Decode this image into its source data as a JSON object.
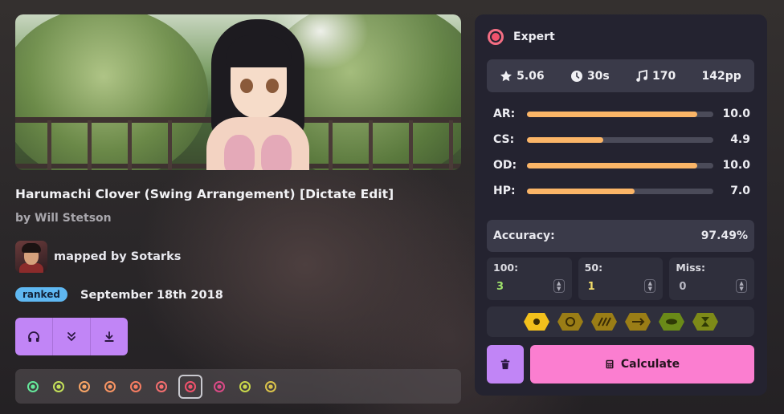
{
  "beatmap": {
    "title": "Harumachi Clover (Swing Arrangement) [Dictate Edit]",
    "artist": "by Will Stetson",
    "mapper": "mapped by Sotarks",
    "status": "ranked",
    "date": "September 18th 2018"
  },
  "actions": [
    {
      "name": "listen-button",
      "icon": "headphones-icon"
    },
    {
      "name": "expand-button",
      "icon": "chevron-double-down-icon"
    },
    {
      "name": "download-button",
      "icon": "download-icon"
    }
  ],
  "difficulty_colors": [
    "#65e89b",
    "#c4e05a",
    "#f8a566",
    "#f79463",
    "#f67d62",
    "#f46e6f",
    "#f0526c",
    "#d94a86",
    "#c9d84a",
    "#d9c24a"
  ],
  "selected_difficulty_index": 6,
  "panel": {
    "difficulty": "Expert",
    "stats": {
      "stars": "5.06",
      "length": "30s",
      "bpm": "170",
      "pp": "142pp"
    },
    "attributes": [
      {
        "label": "AR:",
        "value": "10.0",
        "fraction": 1.0
      },
      {
        "label": "CS:",
        "value": "4.9",
        "fraction": 0.45
      },
      {
        "label": "OD:",
        "value": "10.0",
        "fraction": 1.0
      },
      {
        "label": "HP:",
        "value": "7.0",
        "fraction": 0.63
      }
    ],
    "accuracy_label": "Accuracy:",
    "accuracy_value": "97.49%",
    "hits": [
      {
        "label": "100:",
        "value": "3",
        "color": "#9fe36b"
      },
      {
        "label": "50:",
        "value": "1",
        "color": "#f3dd6a"
      },
      {
        "label": "Miss:",
        "value": "0",
        "color": "#b9b9c4"
      }
    ],
    "mods": [
      {
        "name": "hidden-mod-icon",
        "color": "#f2c01c"
      },
      {
        "name": "hardrock-mod-icon",
        "color": "#9a7d16"
      },
      {
        "name": "doubletime-mod-icon",
        "color": "#9a7d16"
      },
      {
        "name": "flashlight-mod-icon",
        "color": "#9a7d16"
      },
      {
        "name": "easy-mod-icon",
        "color": "#6a8a18"
      },
      {
        "name": "halftime-mod-icon",
        "color": "#7d8a18"
      }
    ],
    "calculate_label": "Calculate"
  }
}
